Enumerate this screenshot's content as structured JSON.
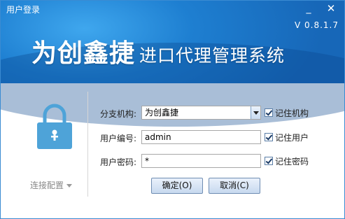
{
  "window": {
    "title": "用户登录",
    "minimize": "_",
    "close": "✕"
  },
  "header": {
    "version": "V 0.8.1.7",
    "brand_main": "为创鑫捷",
    "brand_sub": "进口代理管理系统"
  },
  "form": {
    "branch_label": "分支机构:",
    "branch_value": "为创鑫捷",
    "user_label": "用户编号:",
    "user_value": "admin",
    "pwd_label": "用户密码:",
    "pwd_value": "*"
  },
  "options": {
    "remember_branch": "记住机构",
    "remember_user": "记住用户",
    "remember_pwd": "记住密码"
  },
  "buttons": {
    "ok": "确定(O)",
    "cancel": "取消(C)"
  },
  "connection": {
    "label": "连接配置"
  },
  "icons": {
    "lock": "lock-icon",
    "dropdown": "chevron-down-icon",
    "check": "check-icon"
  },
  "colors": {
    "header": "#1e7fd1",
    "button_border": "#6f8db3"
  }
}
